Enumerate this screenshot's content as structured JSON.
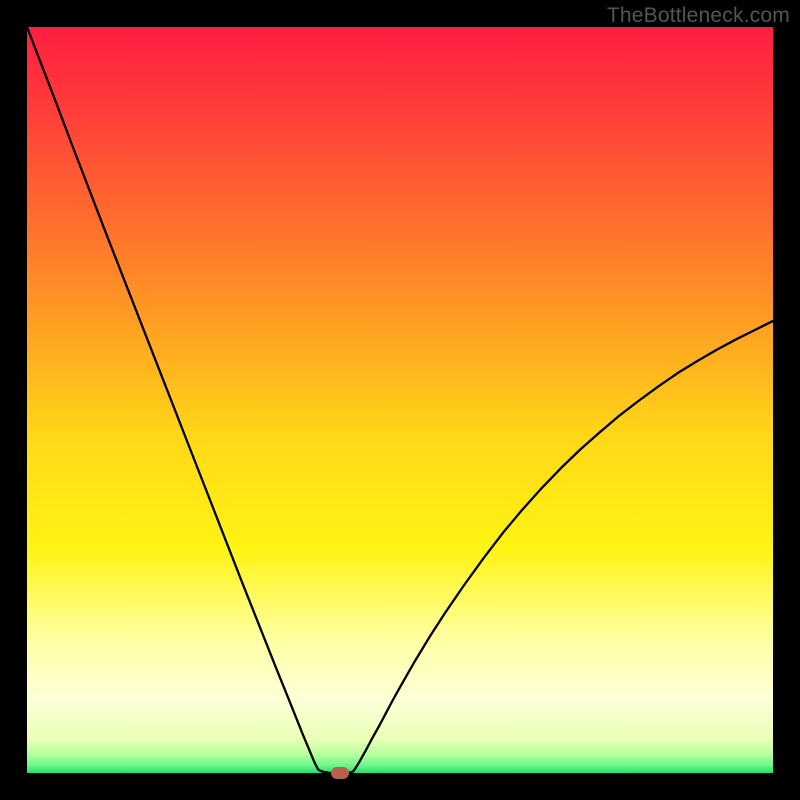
{
  "watermark": "TheBottleneck.com",
  "colors": {
    "marker": "#b5614f",
    "curve": "#000000"
  },
  "chart_data": {
    "type": "line",
    "title": "",
    "xlabel": "",
    "ylabel": "",
    "xlim": [
      0,
      100
    ],
    "ylim": [
      0,
      100
    ],
    "grid": false,
    "legend": false,
    "annotations": [],
    "x": [
      0.0,
      2.0,
      4.0,
      6.0,
      8.0,
      10.3,
      12.6,
      14.9,
      17.2,
      19.5,
      21.8,
      24.1,
      26.4,
      28.7,
      31.0,
      33.3,
      35.0,
      36.0,
      37.0,
      38.0,
      38.5,
      39.0,
      39.3,
      39.6,
      39.9,
      40.2,
      40.5,
      40.8,
      41.1,
      41.4,
      41.8,
      42.5,
      43.0,
      43.5,
      43.7,
      44.0,
      44.5,
      45.4,
      46.3,
      47.2,
      48.1,
      49.0,
      50.0,
      52.0,
      54.0,
      56.0,
      58.6,
      61.2,
      63.8,
      66.4,
      69.0,
      71.6,
      74.2,
      76.8,
      79.4,
      82.0,
      84.6,
      87.2,
      89.8,
      92.4,
      95.0,
      97.6,
      100.0
    ],
    "values": [
      100.0,
      94.8,
      89.6,
      84.3,
      79.1,
      73.1,
      67.2,
      61.3,
      55.4,
      49.5,
      43.6,
      37.7,
      31.8,
      25.9,
      20.1,
      14.3,
      10.1,
      7.6,
      5.1,
      2.7,
      1.5,
      0.5,
      0.3,
      0.2,
      0.1,
      0.1,
      0.0,
      0.0,
      0.0,
      0.0,
      0.0,
      0.0,
      0.0,
      0.1,
      0.2,
      0.6,
      1.4,
      3.0,
      4.7,
      6.3,
      8.0,
      9.7,
      11.5,
      15.0,
      18.3,
      21.4,
      25.2,
      28.8,
      32.2,
      35.3,
      38.2,
      40.9,
      43.4,
      45.7,
      47.9,
      49.9,
      51.8,
      53.6,
      55.2,
      56.7,
      58.1,
      59.4,
      60.6
    ],
    "marker": {
      "x": 42.0,
      "y": 0.0
    },
    "gradient_stops": [
      {
        "offset": 0.0,
        "color": "#ff1e42"
      },
      {
        "offset": 0.1,
        "color": "#ff3a3a"
      },
      {
        "offset": 0.25,
        "color": "#ff6a2e"
      },
      {
        "offset": 0.4,
        "color": "#ffa022"
      },
      {
        "offset": 0.55,
        "color": "#ffd818"
      },
      {
        "offset": 0.7,
        "color": "#fff413"
      },
      {
        "offset": 0.82,
        "color": "#ffffa2"
      },
      {
        "offset": 0.9,
        "color": "#fdffd8"
      },
      {
        "offset": 0.955,
        "color": "#e9ffb5"
      },
      {
        "offset": 0.975,
        "color": "#b6ff9e"
      },
      {
        "offset": 0.99,
        "color": "#6cf588"
      },
      {
        "offset": 1.0,
        "color": "#1ce26f"
      }
    ]
  }
}
